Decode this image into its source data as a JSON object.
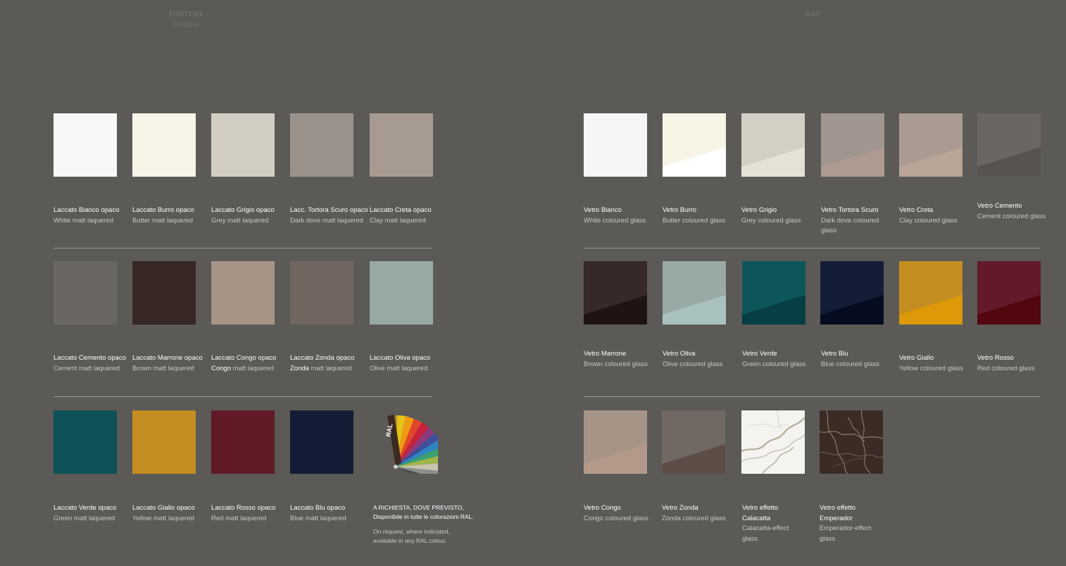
{
  "headers": {
    "left_title": "FINITURE",
    "left_subtitle": "finishes",
    "right_title": "DAY"
  },
  "lacquered": {
    "row1": [
      {
        "name": "Laccato Bianco opaco",
        "desc": "White matt laquered",
        "color": "#f6f8f7"
      },
      {
        "name": "Laccato Burro opaco",
        "desc": "Butter matt laquered",
        "color": "#f8f5e8"
      },
      {
        "name": "Laccato Grigio opaco",
        "desc": "Grey matt laquered",
        "color": "#d3cec4"
      },
      {
        "name": "Lacc. Tortora Scuro opaco",
        "desc": "Dark dove matt laquered",
        "color": "#9b918b"
      },
      {
        "name": "Laccato Creta opaco",
        "desc": "Clay matt laquered",
        "color": "#a79a90"
      }
    ],
    "row2": [
      {
        "name": "Laccato Cemento opaco",
        "desc": "Cement matt laquered",
        "color": "#6a6662"
      },
      {
        "name": "Laccato Marrone opaco",
        "desc": "Brown matt laquered",
        "color": "#372826"
      },
      {
        "name": "Laccato Congo opaco",
        "desc_bold": "Congo",
        "desc": " matt laquered",
        "color": "#a69587"
      },
      {
        "name": "Laccato Zonda opaco",
        "desc_bold": "Zonda",
        "desc": " matt laquered",
        "color": "#716760"
      },
      {
        "name": "Laccato Oliva opaco",
        "desc": "Olive matt laquered",
        "color": "#97a8a5"
      }
    ],
    "row3": [
      {
        "name": "Laccato Verde opaco",
        "desc": "Green matt laquered",
        "color": "#0e5157"
      },
      {
        "name": "Laccato Giallo opaco",
        "desc": "Yellow matt laquered",
        "color": "#c48e22"
      },
      {
        "name": "Laccato Rosso opaco",
        "desc": "Red matt laquered",
        "color": "#621a26"
      },
      {
        "name": "Laccato Blu opaco",
        "desc": "Blue matt laquered",
        "color": "#131e36"
      }
    ],
    "ral_logo_text": "RAL",
    "ral_note": {
      "it": "A RICHIESTA, DOVE PREVISTO,\nDisponibile in tutte le colorazioni RAL.",
      "en": "On request, where indicated,\navailable in any RAL colour."
    }
  },
  "glass": {
    "row1": [
      {
        "name": "Vetro Bianco",
        "desc": "White coloured glass",
        "color": "#f5f7f6",
        "dark": "#f5f7f6"
      },
      {
        "name": "Vetro Burro",
        "desc": "Butter coloured glass",
        "color": "#f8f5e7",
        "dark": "#ffffff"
      },
      {
        "name": "Vetro Grigio",
        "desc": "Grey coloured glass",
        "color": "#d4cfc4",
        "dark": "#e6e1d7"
      },
      {
        "name": "Vetro Tortora Scuro",
        "desc": "Dark dove coloured glass",
        "color": "#a1958f",
        "dark": "#ad9a90"
      },
      {
        "name": "Vetro Creta",
        "desc": "Clay coloured glass",
        "color": "#a99b91",
        "dark": "#b9a596"
      },
      {
        "name": "Vetro Cemento",
        "desc": "Cement coloured glass",
        "color": "#6b6662",
        "dark": "#57534f"
      }
    ],
    "row2": [
      {
        "name": "Vetro Marrone",
        "desc": "Brown coloured glass",
        "color": "#382929",
        "dark": "#1f1413"
      },
      {
        "name": "Vetro Oliva",
        "desc": "Olive coloured glass",
        "color": "#98a9a6",
        "dark": "#a9c2bf"
      },
      {
        "name": "Vetro Verde",
        "desc": "Green coloured glass",
        "color": "#0d565a",
        "dark": "#063e43"
      },
      {
        "name": "Vetro Blu",
        "desc": "Blue coloured glass",
        "color": "#141d36",
        "dark": "#050c1f"
      },
      {
        "name": "Vetro Giallo",
        "desc": "Yellow coloured glass",
        "color": "#c48d20",
        "dark": "#dd9907"
      },
      {
        "name": "Vetro Rosso",
        "desc": "Red coloured glass",
        "color": "#631927",
        "dark": "#54060f"
      }
    ],
    "row3": [
      {
        "name": "Vetro Congo",
        "desc": "Congo coloured glass",
        "color": "#a69487",
        "dark": "#b3998a",
        "texture": "plain"
      },
      {
        "name": "Vetro Zonda",
        "desc": "Zonda coloured glass",
        "color": "#716863",
        "dark": "#5e4d46",
        "texture": "plain"
      },
      {
        "name": "Vetro effetto Calacatta",
        "desc": "Calacatta-effect glass",
        "color": "#f4f3f0",
        "dark": "#f4f3f0",
        "texture": "marble-white"
      },
      {
        "name": "Vetro effetto Emperador",
        "desc": "Emperador-effect glass",
        "color": "#3b2d26",
        "dark": "#3b2d26",
        "texture": "marble-dark"
      }
    ]
  }
}
